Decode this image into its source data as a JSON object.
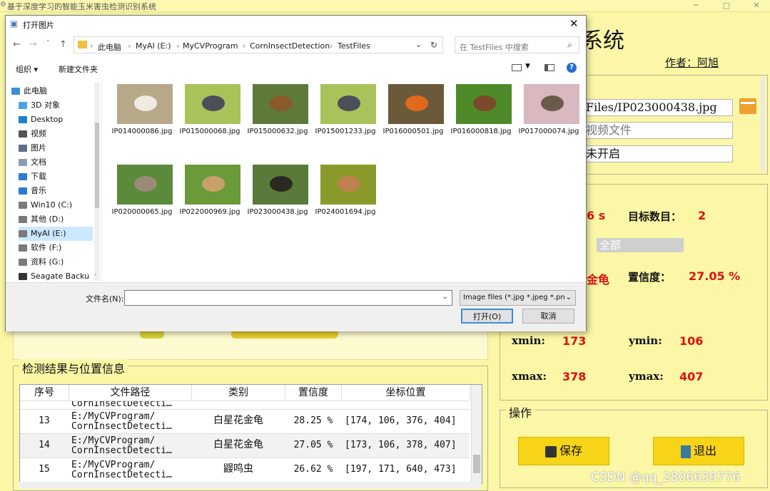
{
  "app": {
    "title": "基于深度学习的智能玉米害虫检测识别系统",
    "heading": "系统",
    "author": "作者：阿旭"
  },
  "file_panel": {
    "image_path": "Files/IP023000438.jpg",
    "video_placeholder": "视频文件",
    "camera_status": "未开启"
  },
  "result_panel": {
    "time_value": "6 s",
    "count_label": "目标数目：",
    "count_value": "2",
    "select_value": "全部",
    "class_value": "金龟",
    "conf_label": "置信度：",
    "conf_value": "27.05 %",
    "xmin_label": "xmin:",
    "xmin_value": "173",
    "ymin_label": "ymin:",
    "ymin_value": "106",
    "xmax_label": "xmax:",
    "xmax_value": "378",
    "ymax_label": "ymax:",
    "ymax_value": "407"
  },
  "ops_panel": {
    "title": "操作",
    "save_label": "保存",
    "exit_label": "退出"
  },
  "table_panel": {
    "title": "检测结果与位置信息",
    "headers": [
      "序号",
      "文件路径",
      "类别",
      "置信度",
      "坐标位置"
    ],
    "partial_row_path": "CornInsectDetecti…",
    "rows": [
      {
        "id": "13",
        "path1": "E:/MyCVProgram/",
        "path2": "CornInsectDetecti…",
        "cls": "白星花金龟",
        "conf": "28.25 %",
        "pos": "[174, 106, 376, 404]"
      },
      {
        "id": "14",
        "path1": "E:/MyCVProgram/",
        "path2": "CornInsectDetecti…",
        "cls": "白星花金龟",
        "conf": "27.05 %",
        "pos": "[173, 106, 378, 407]"
      },
      {
        "id": "15",
        "path1": "E:/MyCVProgram/",
        "path2": "CornInsectDetecti…",
        "cls": "鼹鸣虫",
        "conf": "26.62 %",
        "pos": "[197, 171, 640, 473]"
      }
    ]
  },
  "dialog": {
    "title": "打开图片",
    "breadcrumbs": [
      "此电脑",
      "MyAI (E:)",
      "MyCVProgram",
      "CornInsectDetection",
      "TestFiles"
    ],
    "search_placeholder": "在 TestFiles 中搜索",
    "toolbar": {
      "organize": "组织 ▾",
      "new_folder": "新建文件夹"
    },
    "nav_items": [
      {
        "label": "此电脑",
        "icon": "computer-icon",
        "color": "#3b8ed8"
      },
      {
        "label": "3D 对象",
        "icon": "cube-icon",
        "color": "#4aa3e6"
      },
      {
        "label": "Desktop",
        "icon": "desktop-icon",
        "color": "#1f7fd1"
      },
      {
        "label": "视频",
        "icon": "video-icon",
        "color": "#555555"
      },
      {
        "label": "图片",
        "icon": "picture-icon",
        "color": "#5c6e8a"
      },
      {
        "label": "文档",
        "icon": "document-icon",
        "color": "#8a9bb5"
      },
      {
        "label": "下载",
        "icon": "download-icon",
        "color": "#2b7bd1"
      },
      {
        "label": "音乐",
        "icon": "music-icon",
        "color": "#2b7bd1"
      },
      {
        "label": "Win10 (C:)",
        "icon": "drive-icon",
        "color": "#7a7a7a"
      },
      {
        "label": "其他 (D:)",
        "icon": "drive-icon",
        "color": "#7a7a7a"
      },
      {
        "label": "MyAI (E:)",
        "icon": "drive-icon",
        "color": "#7a7a7a"
      },
      {
        "label": "软件 (F:)",
        "icon": "drive-icon",
        "color": "#7a7a7a"
      },
      {
        "label": "资料 (G:)",
        "icon": "drive-icon",
        "color": "#7a7a7a"
      },
      {
        "label": "Seagate Backu",
        "icon": "external-drive-icon",
        "color": "#333333"
      }
    ],
    "files": [
      {
        "name": "IP014000086.jpg",
        "bg": "#b8a88a",
        "fg": "#f0ebe0"
      },
      {
        "name": "IP015000068.jpg",
        "bg": "#a9c25a",
        "fg": "#4a4f5a"
      },
      {
        "name": "IP015000632.jpg",
        "bg": "#5e7a3a",
        "fg": "#8a5a2a"
      },
      {
        "name": "IP015001233.jpg",
        "bg": "#a9c25a",
        "fg": "#4a4f5a"
      },
      {
        "name": "IP016000501.jpg",
        "bg": "#6a5a3a",
        "fg": "#e06a1a"
      },
      {
        "name": "IP016000818.jpg",
        "bg": "#4f8a2a",
        "fg": "#7a4a2a"
      },
      {
        "name": "IP017000074.jpg",
        "bg": "#d9b8c0",
        "fg": "#6a5a4a"
      },
      {
        "name": "IP020000065.jpg",
        "bg": "#5a8a3a",
        "fg": "#9a8a7a"
      },
      {
        "name": "IP022000969.jpg",
        "bg": "#6a9a3a",
        "fg": "#c9a06a"
      },
      {
        "name": "IP023000438.jpg",
        "bg": "#5a7a3a",
        "fg": "#2a2a20"
      },
      {
        "name": "IP024001694.jpg",
        "bg": "#8a9a2a",
        "fg": "#c08050"
      }
    ],
    "filename_label": "文件名(N):",
    "filename_value": "",
    "filter_value": "Image files (*.jpg *.jpeg *.pn",
    "open_label": "打开(O)",
    "cancel_label": "取消"
  },
  "watermark": "CSDN @qq_2806639776",
  "colors": {
    "app_bg": "#fbf7a6",
    "accent_button": "#f7d417",
    "value_red": "#e01010"
  }
}
